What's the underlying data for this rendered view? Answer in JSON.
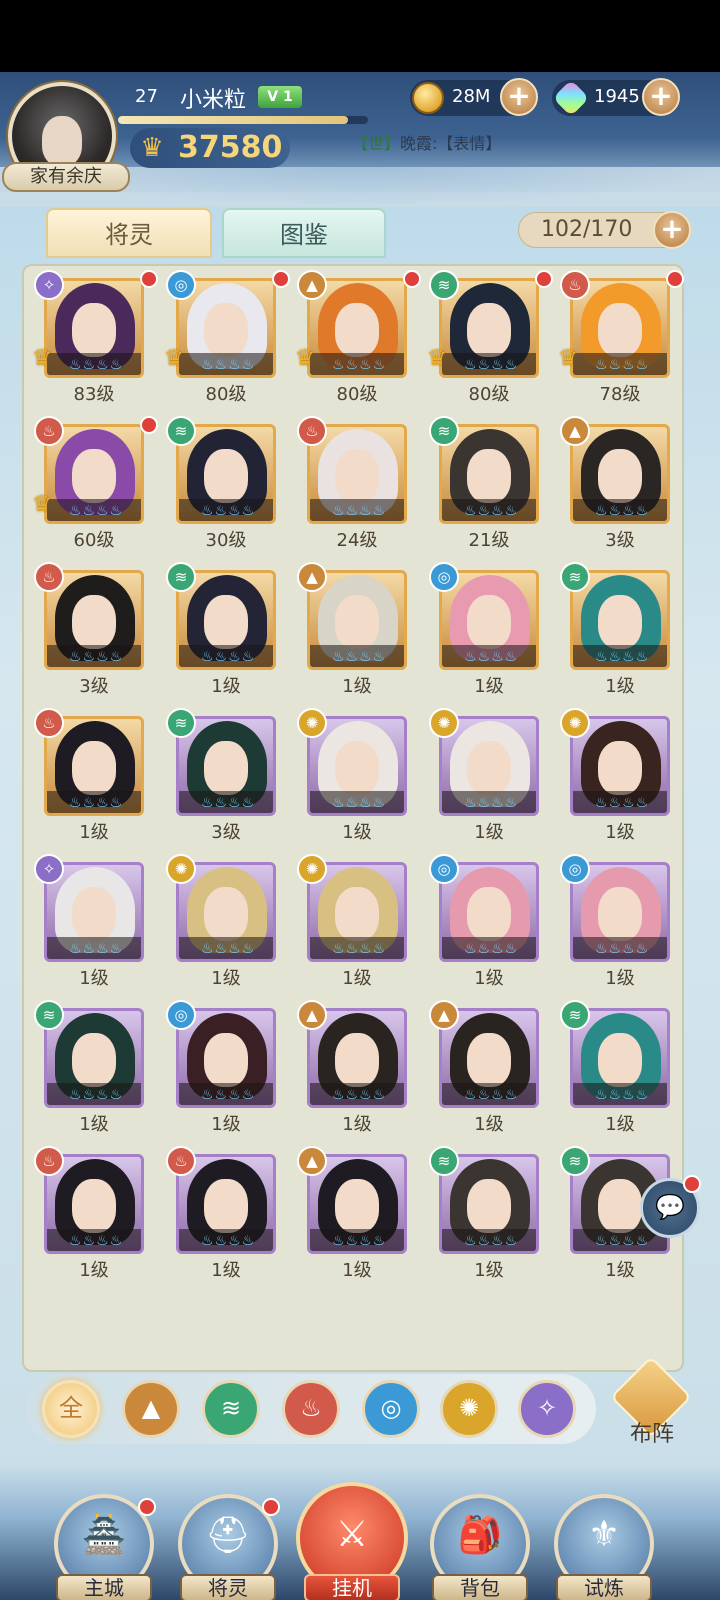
{
  "player": {
    "avatar_title": "家有余庆",
    "level": "27",
    "name": "小米粒",
    "vip": "V 1",
    "exp_fraction": 0.92,
    "power": "37580"
  },
  "resources": {
    "gold": "28M",
    "gems": "1945"
  },
  "chat": {
    "channel": "【世】",
    "message": "晚霞:【表情】"
  },
  "tabs": {
    "heroes": "将灵",
    "codex": "图鉴"
  },
  "hero_count": "102/170",
  "heroes": [
    {
      "level": "83级",
      "element": "dark",
      "frame": "gold",
      "red_dot": true,
      "deployed": true,
      "hair": "#4a2a5a"
    },
    {
      "level": "80级",
      "element": "water",
      "frame": "gold",
      "red_dot": true,
      "deployed": true,
      "hair": "#e8e8ee"
    },
    {
      "level": "80级",
      "element": "earth",
      "frame": "gold",
      "red_dot": true,
      "deployed": true,
      "hair": "#e07a2a"
    },
    {
      "level": "80级",
      "element": "wind",
      "frame": "gold",
      "red_dot": true,
      "deployed": true,
      "hair": "#1e2838"
    },
    {
      "level": "78级",
      "element": "fire",
      "frame": "gold",
      "red_dot": true,
      "deployed": true,
      "hair": "#f29a2a"
    },
    {
      "level": "60级",
      "element": "fire",
      "frame": "gold",
      "red_dot": true,
      "deployed": true,
      "hair": "#8a4aa8"
    },
    {
      "level": "30级",
      "element": "wind",
      "frame": "gold",
      "red_dot": false,
      "deployed": false,
      "hair": "#222436"
    },
    {
      "level": "24级",
      "element": "fire",
      "frame": "gold",
      "red_dot": false,
      "deployed": false,
      "hair": "#e9e2e0"
    },
    {
      "level": "21级",
      "element": "wind",
      "frame": "gold",
      "red_dot": false,
      "deployed": false,
      "hair": "#3a3530"
    },
    {
      "level": "3级",
      "element": "earth",
      "frame": "gold",
      "red_dot": false,
      "deployed": false,
      "hair": "#2a2624"
    },
    {
      "level": "3级",
      "element": "fire",
      "frame": "gold",
      "red_dot": false,
      "deployed": false,
      "hair": "#1f1c1c"
    },
    {
      "level": "1级",
      "element": "wind",
      "frame": "gold",
      "red_dot": false,
      "deployed": false,
      "hair": "#232536"
    },
    {
      "level": "1级",
      "element": "earth",
      "frame": "gold",
      "red_dot": false,
      "deployed": false,
      "hair": "#d8d4c8"
    },
    {
      "level": "1级",
      "element": "water",
      "frame": "gold",
      "red_dot": false,
      "deployed": false,
      "hair": "#e79ab0"
    },
    {
      "level": "1级",
      "element": "wind",
      "frame": "gold",
      "red_dot": false,
      "deployed": false,
      "hair": "#2a8a88"
    },
    {
      "level": "1级",
      "element": "fire",
      "frame": "gold",
      "red_dot": false,
      "deployed": false,
      "hair": "#1e1c22"
    },
    {
      "level": "3级",
      "element": "wind",
      "frame": "purple",
      "red_dot": false,
      "deployed": false,
      "hair": "#1e3a34"
    },
    {
      "level": "1级",
      "element": "light",
      "frame": "purple",
      "red_dot": false,
      "deployed": false,
      "hair": "#ece6e2"
    },
    {
      "level": "1级",
      "element": "light",
      "frame": "purple",
      "red_dot": false,
      "deployed": false,
      "hair": "#ece6e2"
    },
    {
      "level": "1级",
      "element": "light",
      "frame": "purple",
      "red_dot": false,
      "deployed": false,
      "hair": "#3a2420"
    },
    {
      "level": "1级",
      "element": "dark",
      "frame": "purple",
      "red_dot": false,
      "deployed": false,
      "hair": "#e8e6e6"
    },
    {
      "level": "1级",
      "element": "light",
      "frame": "purple",
      "red_dot": false,
      "deployed": false,
      "hair": "#d8bf82"
    },
    {
      "level": "1级",
      "element": "light",
      "frame": "purple",
      "red_dot": false,
      "deployed": false,
      "hair": "#d8bf82"
    },
    {
      "level": "1级",
      "element": "water",
      "frame": "purple",
      "red_dot": false,
      "deployed": false,
      "hair": "#e69aae"
    },
    {
      "level": "1级",
      "element": "water",
      "frame": "purple",
      "red_dot": false,
      "deployed": false,
      "hair": "#e69aae"
    },
    {
      "level": "1级",
      "element": "wind",
      "frame": "purple",
      "red_dot": false,
      "deployed": false,
      "hair": "#1e3a34"
    },
    {
      "level": "1级",
      "element": "water",
      "frame": "purple",
      "red_dot": false,
      "deployed": false,
      "hair": "#3a2024"
    },
    {
      "level": "1级",
      "element": "earth",
      "frame": "purple",
      "red_dot": false,
      "deployed": false,
      "hair": "#2a2420"
    },
    {
      "level": "1级",
      "element": "earth",
      "frame": "purple",
      "red_dot": false,
      "deployed": false,
      "hair": "#2a2420"
    },
    {
      "level": "1级",
      "element": "wind",
      "frame": "purple",
      "red_dot": false,
      "deployed": false,
      "hair": "#2a8a88"
    },
    {
      "level": "1级",
      "element": "fire",
      "frame": "purple",
      "red_dot": false,
      "deployed": false,
      "hair": "#1e1c22"
    },
    {
      "level": "1级",
      "element": "fire",
      "frame": "purple",
      "red_dot": false,
      "deployed": false,
      "hair": "#1e1c22"
    },
    {
      "level": "1级",
      "element": "earth",
      "frame": "purple",
      "red_dot": false,
      "deployed": false,
      "hair": "#1e1c22"
    },
    {
      "level": "1级",
      "element": "wind",
      "frame": "purple",
      "red_dot": false,
      "deployed": false,
      "hair": "#3a3530"
    },
    {
      "level": "1级",
      "element": "wind",
      "frame": "purple",
      "red_dot": false,
      "deployed": false,
      "hair": "#3a3530"
    }
  ],
  "element_icons": {
    "wind": "≋",
    "water": "◎",
    "fire": "♨",
    "earth": "▲",
    "light": "✺",
    "dark": "✧"
  },
  "filters": [
    {
      "key": "all",
      "label": "全"
    },
    {
      "key": "earth",
      "label": ""
    },
    {
      "key": "wind",
      "label": ""
    },
    {
      "key": "fire",
      "label": ""
    },
    {
      "key": "water",
      "label": ""
    },
    {
      "key": "light",
      "label": ""
    },
    {
      "key": "dark",
      "label": ""
    }
  ],
  "formation_label": "布阵",
  "nav": [
    {
      "label": "主城",
      "red_dot": true,
      "glyph": "🏯"
    },
    {
      "label": "将灵",
      "red_dot": true,
      "glyph": "⛑"
    },
    {
      "label": "挂机",
      "red_dot": false,
      "glyph": "⚔"
    },
    {
      "label": "背包",
      "red_dot": false,
      "glyph": "🎒"
    },
    {
      "label": "试炼",
      "red_dot": false,
      "glyph": "⚜"
    }
  ],
  "colors": {
    "accent_gold": "#f6d57b",
    "red_dot": "#e0403a",
    "frame_gold": "#e3a84a",
    "frame_purple": "#a580c9"
  }
}
